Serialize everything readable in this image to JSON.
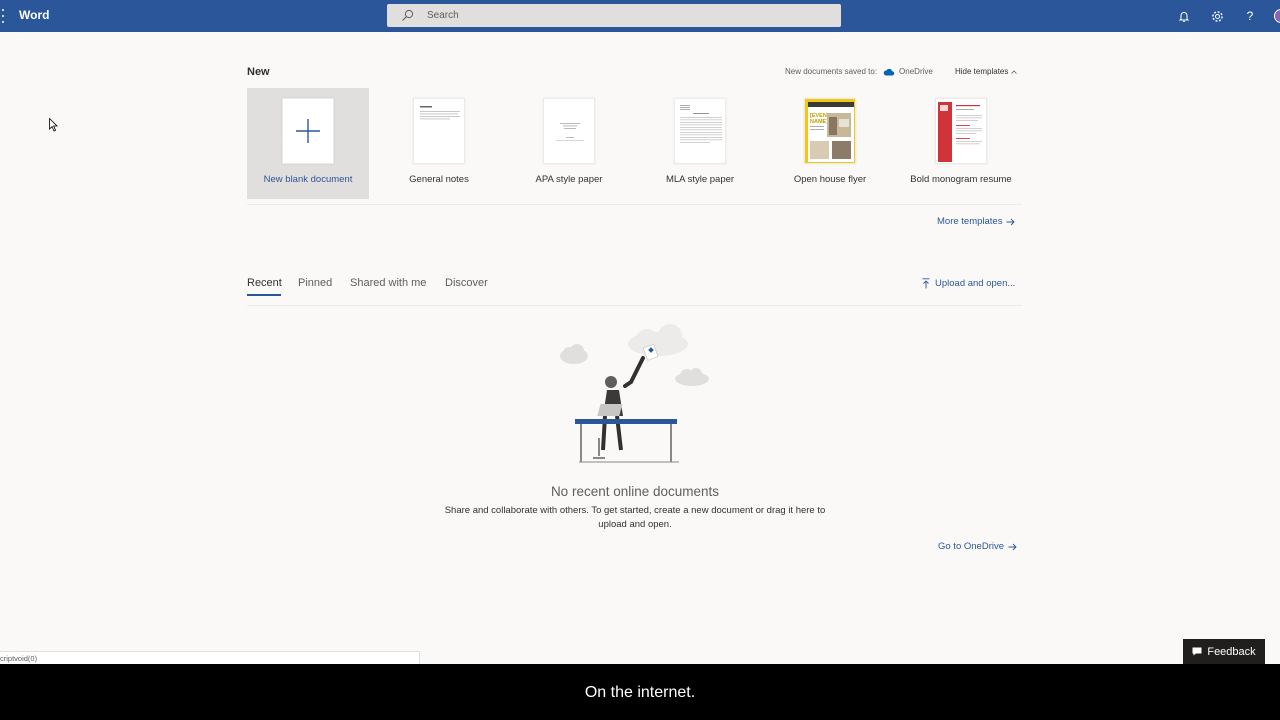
{
  "app": {
    "name": "Word"
  },
  "search": {
    "placeholder": "Search"
  },
  "new_section": {
    "heading": "New",
    "saved_to_label": "New documents saved to:",
    "saved_to_location": "OneDrive",
    "hide_templates_label": "Hide templates",
    "templates": [
      {
        "label": "New blank document",
        "selected": true
      },
      {
        "label": "General notes"
      },
      {
        "label": "APA style paper"
      },
      {
        "label": "MLA style paper"
      },
      {
        "label": "Open house flyer",
        "thumb_text": "[EVENT NAME]"
      },
      {
        "label": "Bold monogram resume"
      }
    ],
    "more_templates_label": "More templates"
  },
  "tabs": [
    {
      "label": "Recent",
      "active": true
    },
    {
      "label": "Pinned"
    },
    {
      "label": "Shared with me"
    },
    {
      "label": "Discover"
    }
  ],
  "upload_label": "Upload and open...",
  "empty_state": {
    "title": "No recent online documents",
    "description": "Share and collaborate with others. To get started, create a new document or drag it here to upload and open."
  },
  "go_onedrive_label": "Go to OneDrive",
  "status_text": "criptvoid(0)",
  "feedback_label": "Feedback",
  "caption": "On the internet.",
  "colors": {
    "brand": "#2b579a",
    "accent_avatar": "#8764b8",
    "flyer": "#f2c811",
    "resume": "#d13438"
  },
  "icons": [
    "app-launcher-icon",
    "search-icon",
    "bell-icon",
    "gear-icon",
    "help-icon",
    "cloud-icon",
    "chevron-up-icon",
    "arrow-right-icon",
    "upload-icon",
    "feedback-icon"
  ]
}
